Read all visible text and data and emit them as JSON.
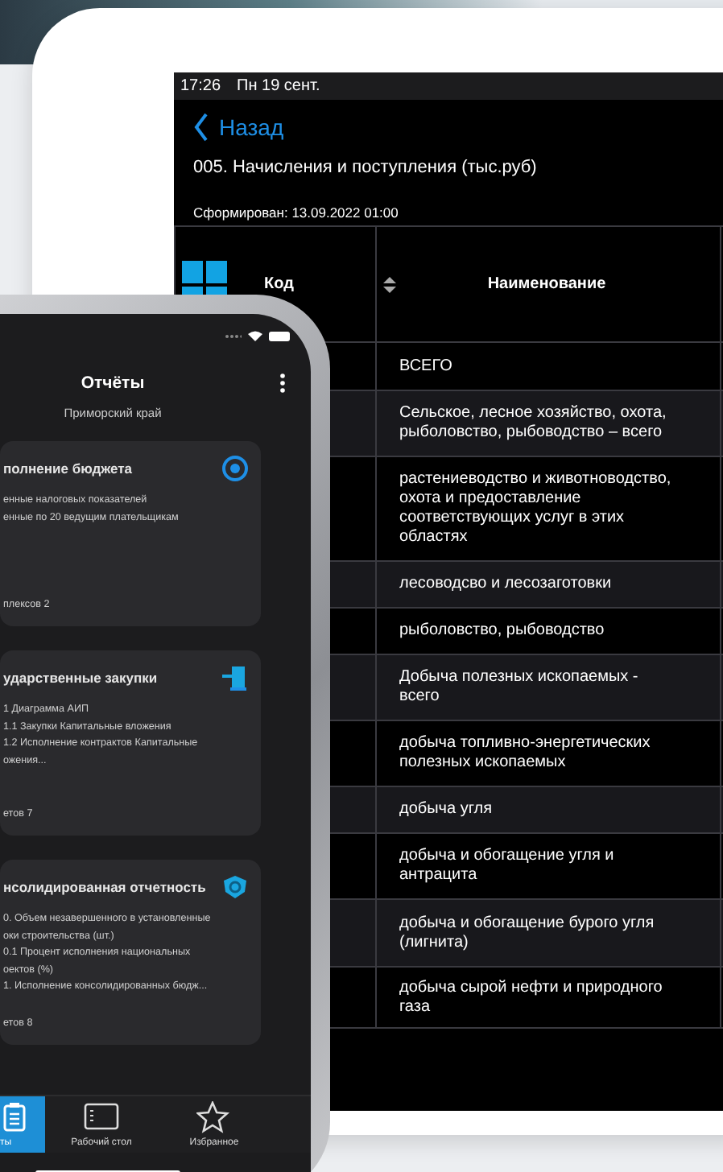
{
  "tablet": {
    "status_bar": {
      "time": "17:26",
      "date": "Пн 19 сент."
    },
    "back_button": "Назад",
    "report_title": "005. Начисления и поступления (тыс.руб)",
    "generated": "Сформирован: 13.09.2022 01:00",
    "table": {
      "columns": [
        "Код",
        "Наименование"
      ],
      "rows": [
        {
          "name": "ВСЕГО"
        },
        {
          "name": "Сельское, лесное хозяйство, охота, рыболовство, рыбоводство – всего"
        },
        {
          "name": "растениеводство и животноводство, охота и предоставление соответствующих услуг в этих областях"
        },
        {
          "name": "лесоводсво и лесозаготовки"
        },
        {
          "name": "рыболовство, рыбоводство"
        },
        {
          "name": "Добыча полезных ископаемых - всего"
        },
        {
          "name": "добыча топливно-энергетических полезных ископаемых"
        },
        {
          "name": "добыча угля"
        },
        {
          "name": "добыча и обогащение угля и антрацита"
        },
        {
          "name": "добыча и обогащение бурого угля (лигнита)"
        },
        {
          "name": "добыча сырой нефти и природного газа"
        }
      ]
    }
  },
  "phone": {
    "title": "Отчёты",
    "subtitle": "Приморский край",
    "cards": [
      {
        "title": "полнение бюджета",
        "kind": "target",
        "items": [
          "енные налоговых показателей",
          "енные по 20 ведущим плательщикам"
        ],
        "count": "плексов 2"
      },
      {
        "title": "ударственные закупки",
        "kind": "door",
        "items": [
          "1 Диаграмма АИП",
          "1.1 Закупки Капитальные вложения",
          "1.2 Исполнение контрактов Капитальные",
          "ожения..."
        ],
        "count": "етов 7"
      },
      {
        "title": "нсолидированная отчетность",
        "kind": "shield",
        "items": [
          "0. Объем незавершенного в установленные",
          "оки строительства (шт.)",
          "0.1 Процент исполнения национальных",
          "оектов (%)",
          "1. Исполнение консолидированных бюдж..."
        ],
        "count": "етов 8"
      }
    ],
    "tabs": [
      {
        "label": "ты",
        "kind": "clipboard",
        "selected": true
      },
      {
        "label": "Рабочий стол",
        "kind": "desktop",
        "selected": false
      },
      {
        "label": "Избранное",
        "kind": "star",
        "selected": false
      }
    ]
  }
}
